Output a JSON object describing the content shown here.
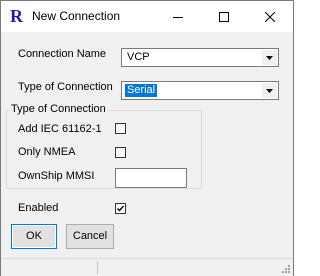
{
  "window": {
    "title": "New Connection",
    "icon_letter": "R",
    "accent_color": "#1f22a8"
  },
  "titlebar_buttons": {
    "minimize": "minimize-icon",
    "maximize": "maximize-icon",
    "close": "close-icon"
  },
  "form": {
    "connection_name": {
      "label": "Connection Name",
      "value": "VCP"
    },
    "connection_type": {
      "label": "Type of Connection",
      "value": "Serial"
    },
    "group": {
      "title": "Type of Connection",
      "add_iec": {
        "label": "Add IEC 61162-1",
        "checked": false
      },
      "only_nmea": {
        "label": "Only NMEA",
        "checked": false
      },
      "ownship_mmsi": {
        "label": "OwnShip MMSI",
        "value": ""
      }
    },
    "enabled": {
      "label": "Enabled",
      "checked": true
    }
  },
  "buttons": {
    "ok": "OK",
    "cancel": "Cancel"
  },
  "colors": {
    "selection": "#0078d7",
    "window_bg": "#f0f0f0"
  }
}
